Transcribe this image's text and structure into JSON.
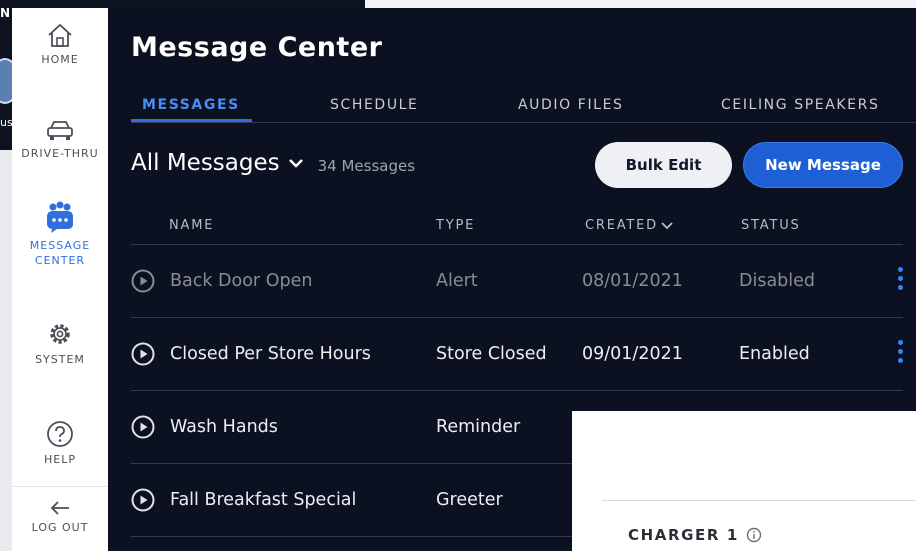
{
  "background_window": {
    "corner_text_top": "N",
    "corner_text_mid": "us"
  },
  "sidebar": {
    "items": [
      {
        "label": "HOME",
        "icon": "home-icon"
      },
      {
        "label": "DRIVE-THRU",
        "icon": "car-icon"
      },
      {
        "label_line1": "MESSAGE",
        "label_line2": "CENTER",
        "icon": "message-center-icon",
        "active": true
      },
      {
        "label": "SYSTEM",
        "icon": "gear-icon"
      },
      {
        "label": "HELP",
        "icon": "help-icon"
      },
      {
        "label": "LOG OUT",
        "icon": "arrow-left-icon"
      }
    ]
  },
  "main": {
    "title": "Message Center",
    "tabs": [
      {
        "label": "MESSAGES",
        "active": true
      },
      {
        "label": "SCHEDULE"
      },
      {
        "label": "AUDIO FILES"
      },
      {
        "label": "CEILING SPEAKERS"
      }
    ],
    "filter": {
      "selected": "All Messages",
      "count_text": "34 Messages"
    },
    "buttons": {
      "bulk_edit": "Bulk Edit",
      "new_message": "New Message"
    },
    "columns": {
      "name": "NAME",
      "type": "TYPE",
      "created": "CREATED",
      "status": "STATUS"
    },
    "rows": [
      {
        "name": "Back Door Open",
        "type": "Alert",
        "created": "08/01/2021",
        "status": "Disabled"
      },
      {
        "name": "Closed Per Store Hours",
        "type": "Store Closed",
        "created": "09/01/2021",
        "status": "Enabled"
      },
      {
        "name": "Wash Hands",
        "type": "Reminder",
        "created": "",
        "status": ""
      },
      {
        "name": "Fall Breakfast Special",
        "type": "Greeter",
        "created": "",
        "status": ""
      }
    ]
  },
  "overlay": {
    "charger_label": "CHARGER 1"
  },
  "colors": {
    "accent": "#2f6fde",
    "panel_bg": "#0b1120",
    "kebab": "#3b82f6"
  }
}
